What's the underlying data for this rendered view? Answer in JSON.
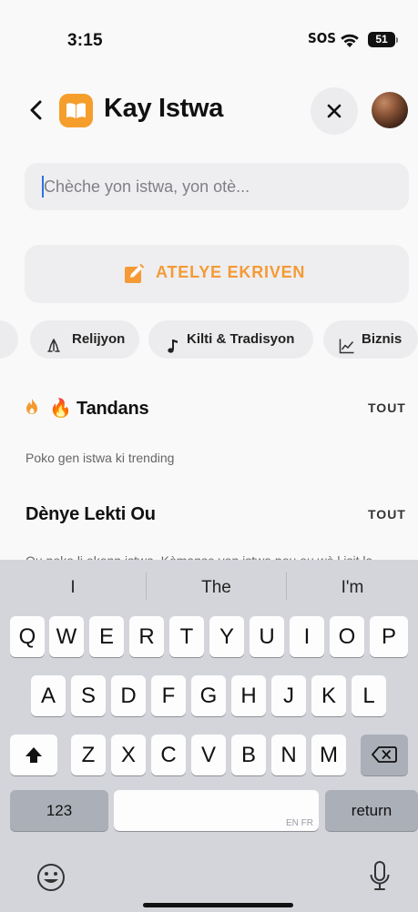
{
  "status_bar": {
    "time": "3:15",
    "sos": "SOS",
    "battery": "51"
  },
  "header": {
    "title": "Kay Istwa"
  },
  "search": {
    "placeholder": "Chèche yon istwa, yon otè..."
  },
  "workshop": {
    "label": "ATELYE EKRIVEN"
  },
  "categories": [
    {
      "label": "Relijyon",
      "icon": "praying-hands-icon"
    },
    {
      "label": "Kilti & Tradisyon",
      "icon": "music-note-icon"
    },
    {
      "label": "Biznis",
      "icon": "chart-line-icon"
    }
  ],
  "trending": {
    "title": "🔥 Tandans",
    "see_all": "TOUT",
    "empty": "Poko gen istwa ki trending"
  },
  "recent": {
    "title": "Dènye Lekti Ou",
    "see_all": "TOUT",
    "empty": "Ou poko li okenn istwa. Kòmanse yon istwa pou ou wè l isit la."
  },
  "keyboard": {
    "suggestions": [
      "I",
      "The",
      "I'm"
    ],
    "row1": [
      "Q",
      "W",
      "E",
      "R",
      "T",
      "Y",
      "U",
      "I",
      "O",
      "P"
    ],
    "row2": [
      "A",
      "S",
      "D",
      "F",
      "G",
      "H",
      "J",
      "K",
      "L"
    ],
    "row3": [
      "Z",
      "X",
      "C",
      "V",
      "B",
      "N",
      "M"
    ],
    "numbers_key": "123",
    "space_lang": "EN FR",
    "return_key": "return"
  }
}
